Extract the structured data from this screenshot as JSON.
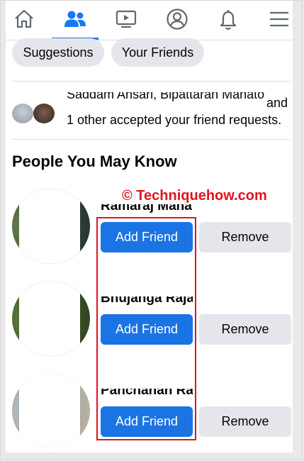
{
  "nav": {
    "items": [
      {
        "icon": "home-icon",
        "active": false
      },
      {
        "icon": "friends-icon",
        "active": true
      },
      {
        "icon": "watch-icon",
        "active": false
      },
      {
        "icon": "profile-icon",
        "active": false
      },
      {
        "icon": "notifications-icon",
        "active": false
      },
      {
        "icon": "menu-icon",
        "active": false
      }
    ],
    "accent": "#1877f2"
  },
  "chips": {
    "suggestions": "Suggestions",
    "your_friends": "Your Friends"
  },
  "accepted": {
    "names_cut": "Saddam Ansari, Bipattaran Mahato",
    "and": "and",
    "text": "1 other accepted your friend requests."
  },
  "section_title": "People You May Know",
  "watermark": "© Techniquehow.com",
  "suggestions": [
    {
      "name": "Ramaraj Mahanty",
      "add_label": "Add Friend",
      "remove_label": "Remove"
    },
    {
      "name": "Bhujanga Rajak",
      "add_label": "Add Friend",
      "remove_label": "Remove"
    },
    {
      "name": "Panchanan Ra",
      "add_label": "Add Friend",
      "remove_label": "Remove"
    }
  ],
  "colors": {
    "primary_button": "#1b74e4",
    "secondary_button": "#e4e6eb",
    "highlight_box": "#e0141c"
  }
}
